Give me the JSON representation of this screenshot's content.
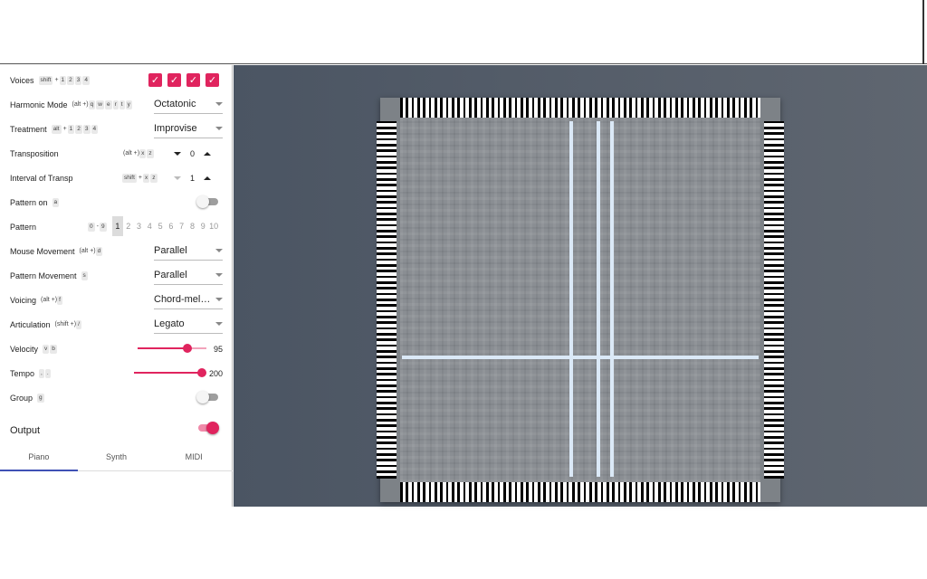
{
  "controls": {
    "voices": {
      "label": "Voices",
      "keys": [
        "shift",
        "+",
        "1",
        "2",
        "3",
        "4"
      ]
    },
    "harmonic_mode": {
      "label": "Harmonic Mode",
      "keys": [
        "(alt +)",
        "q",
        "w",
        "e",
        "r",
        "t",
        "y"
      ],
      "value": "Octatonic"
    },
    "treatment": {
      "label": "Treatment",
      "keys": [
        "alt",
        "+",
        "1",
        "2",
        "3",
        "4"
      ],
      "value": "Improvise"
    },
    "transposition": {
      "label": "Transposition",
      "keys": [
        "(alt +)",
        "x",
        "z"
      ],
      "value": "0"
    },
    "interval": {
      "label": "Interval of Transp",
      "keys": [
        "shift",
        "+",
        "x",
        "z"
      ],
      "value": "1"
    },
    "pattern_on": {
      "label": "Pattern on",
      "keys": [
        "a"
      ]
    },
    "pattern": {
      "label": "Pattern",
      "keys": [
        "0",
        "-",
        "9"
      ],
      "cells": [
        "1",
        "2",
        "3",
        "4",
        "5",
        "6",
        "7",
        "8",
        "9",
        "10"
      ]
    },
    "mouse_movement": {
      "label": "Mouse Movement",
      "keys": [
        "(alt +)",
        "d"
      ],
      "value": "Parallel"
    },
    "pattern_movement": {
      "label": "Pattern Movement",
      "keys": [
        "s"
      ],
      "value": "Parallel"
    },
    "voicing": {
      "label": "Voicing",
      "keys": [
        "(alt +)",
        "f"
      ],
      "value": "Chord-melody"
    },
    "articulation": {
      "label": "Articulation",
      "keys": [
        "(shift +)",
        "/"
      ],
      "value": "Legato"
    },
    "velocity": {
      "label": "Velocity",
      "keys": [
        "v",
        "b"
      ],
      "value": "95"
    },
    "tempo": {
      "label": "Tempo",
      "keys": [
        ",",
        "."
      ],
      "value": "200"
    },
    "group": {
      "label": "Group",
      "keys": [
        "g"
      ]
    }
  },
  "voices_checked": [
    true,
    true,
    true,
    true
  ],
  "pattern_selected": "1",
  "velocity_fraction": 0.75,
  "tempo_fraction": 1.0,
  "toggles": {
    "pattern_on": false,
    "group": false,
    "output": true
  },
  "output": {
    "label": "Output",
    "tabs": [
      "Piano",
      "Synth",
      "MIDI"
    ],
    "active_tab": "Piano"
  },
  "colors": {
    "accent": "#e0245e",
    "tab_indicator": "#3f51b5"
  }
}
